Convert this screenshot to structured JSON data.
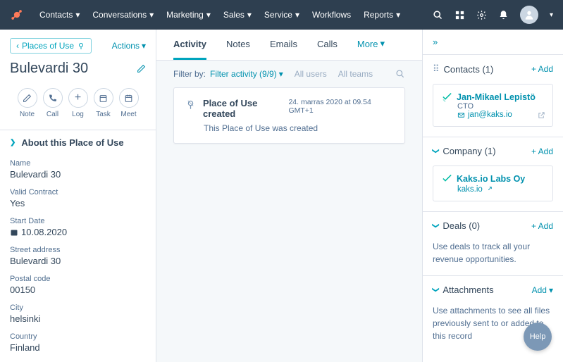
{
  "nav": {
    "items": [
      "Contacts",
      "Conversations",
      "Marketing",
      "Sales",
      "Service",
      "Workflows",
      "Reports"
    ]
  },
  "left": {
    "back_label": "Places of Use",
    "actions_label": "Actions",
    "title": "Bulevardi 30",
    "actions": [
      "Note",
      "Call",
      "Log",
      "Task",
      "Meet"
    ],
    "about_header": "About this Place of Use",
    "fields": [
      {
        "label": "Name",
        "value": "Bulevardi 30"
      },
      {
        "label": "Valid Contract",
        "value": "Yes"
      },
      {
        "label": "Start Date",
        "value": "10.08.2020",
        "icon": "calendar"
      },
      {
        "label": "Street address",
        "value": "Bulevardi 30"
      },
      {
        "label": "Postal code",
        "value": "00150"
      },
      {
        "label": "City",
        "value": "helsinki"
      },
      {
        "label": "Country",
        "value": "Finland"
      }
    ]
  },
  "mid": {
    "tabs": [
      "Activity",
      "Notes",
      "Emails",
      "Calls"
    ],
    "more_label": "More",
    "filter_by_label": "Filter by:",
    "filter_activity": "Filter activity (9/9)",
    "all_users": "All users",
    "all_teams": "All teams",
    "activity": {
      "title": "Place of Use created",
      "timestamp": "24. marras 2020 at 09.54 GMT+1",
      "body": "This Place of Use was created"
    }
  },
  "right": {
    "contacts": {
      "title": "Contacts (1)",
      "add": "+ Add",
      "name": "Jan-Mikael Lepistö",
      "role": "CTO",
      "email": "jan@kaks.io"
    },
    "company": {
      "title": "Company (1)",
      "add": "+ Add",
      "name": "Kaks.io Labs Oy",
      "domain": "kaks.io"
    },
    "deals": {
      "title": "Deals (0)",
      "add": "+ Add",
      "text": "Use deals to track all your revenue opportunities."
    },
    "attachments": {
      "title": "Attachments",
      "add": "Add",
      "text": "Use attachments to see all files previously sent to or added to this record"
    }
  },
  "help_label": "Help"
}
